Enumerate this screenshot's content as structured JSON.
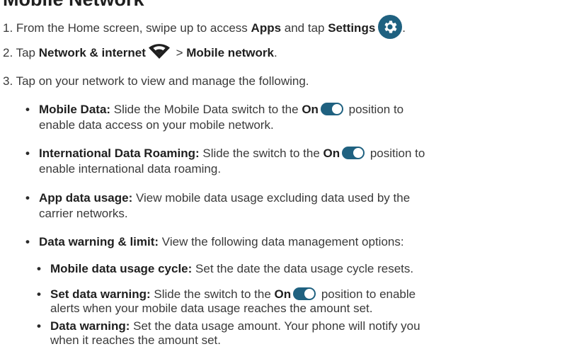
{
  "title": "Mobile Network",
  "colors": {
    "accent": "#1f6180",
    "text": "#3a3a3a"
  },
  "steps": {
    "s1": {
      "pre": "1. From the Home screen, swipe up to access ",
      "b1": "Apps",
      "mid": " and tap ",
      "b2": "Settings",
      "post": ".",
      "icon": "gear-icon"
    },
    "s2": {
      "pre": "2. Tap ",
      "b1": "Network & internet",
      "icon": "wifi-icon",
      "mid": " > ",
      "b2": "Mobile network",
      "post": "."
    },
    "s3": {
      "text": "3. Tap on your network to view and manage the following."
    }
  },
  "bullets": {
    "mobile_data": {
      "label": "Mobile Data:",
      "pre": " Slide the Mobile Data switch to the ",
      "on": "On",
      "post": " position to",
      "cont": "enable data access on your mobile network."
    },
    "roaming": {
      "label": "International Data Roaming:",
      "pre": " Slide the switch to the ",
      "on": "On",
      "post": " position to",
      "cont": "enable international data roaming."
    },
    "app_usage": {
      "label": "App data usage:",
      "post": " View mobile data usage excluding data used by the",
      "cont": "carrier networks."
    },
    "warning_limit": {
      "label": "Data warning & limit:",
      "post": " View the following data management options:"
    }
  },
  "sub_bullets": {
    "cycle": {
      "label": "Mobile data usage cycle:",
      "post": " Set the date the data usage cycle resets."
    },
    "set_warning": {
      "label": "Set data warning:",
      "pre": " Slide the switch to the ",
      "on": "On",
      "post": " position to enable",
      "cont": "alerts when your mobile data usage reaches the amount set."
    },
    "warning": {
      "label": "Data warning:",
      "post": " Set the data usage amount. Your phone will notify you",
      "cont": "when it reaches the amount set."
    }
  }
}
